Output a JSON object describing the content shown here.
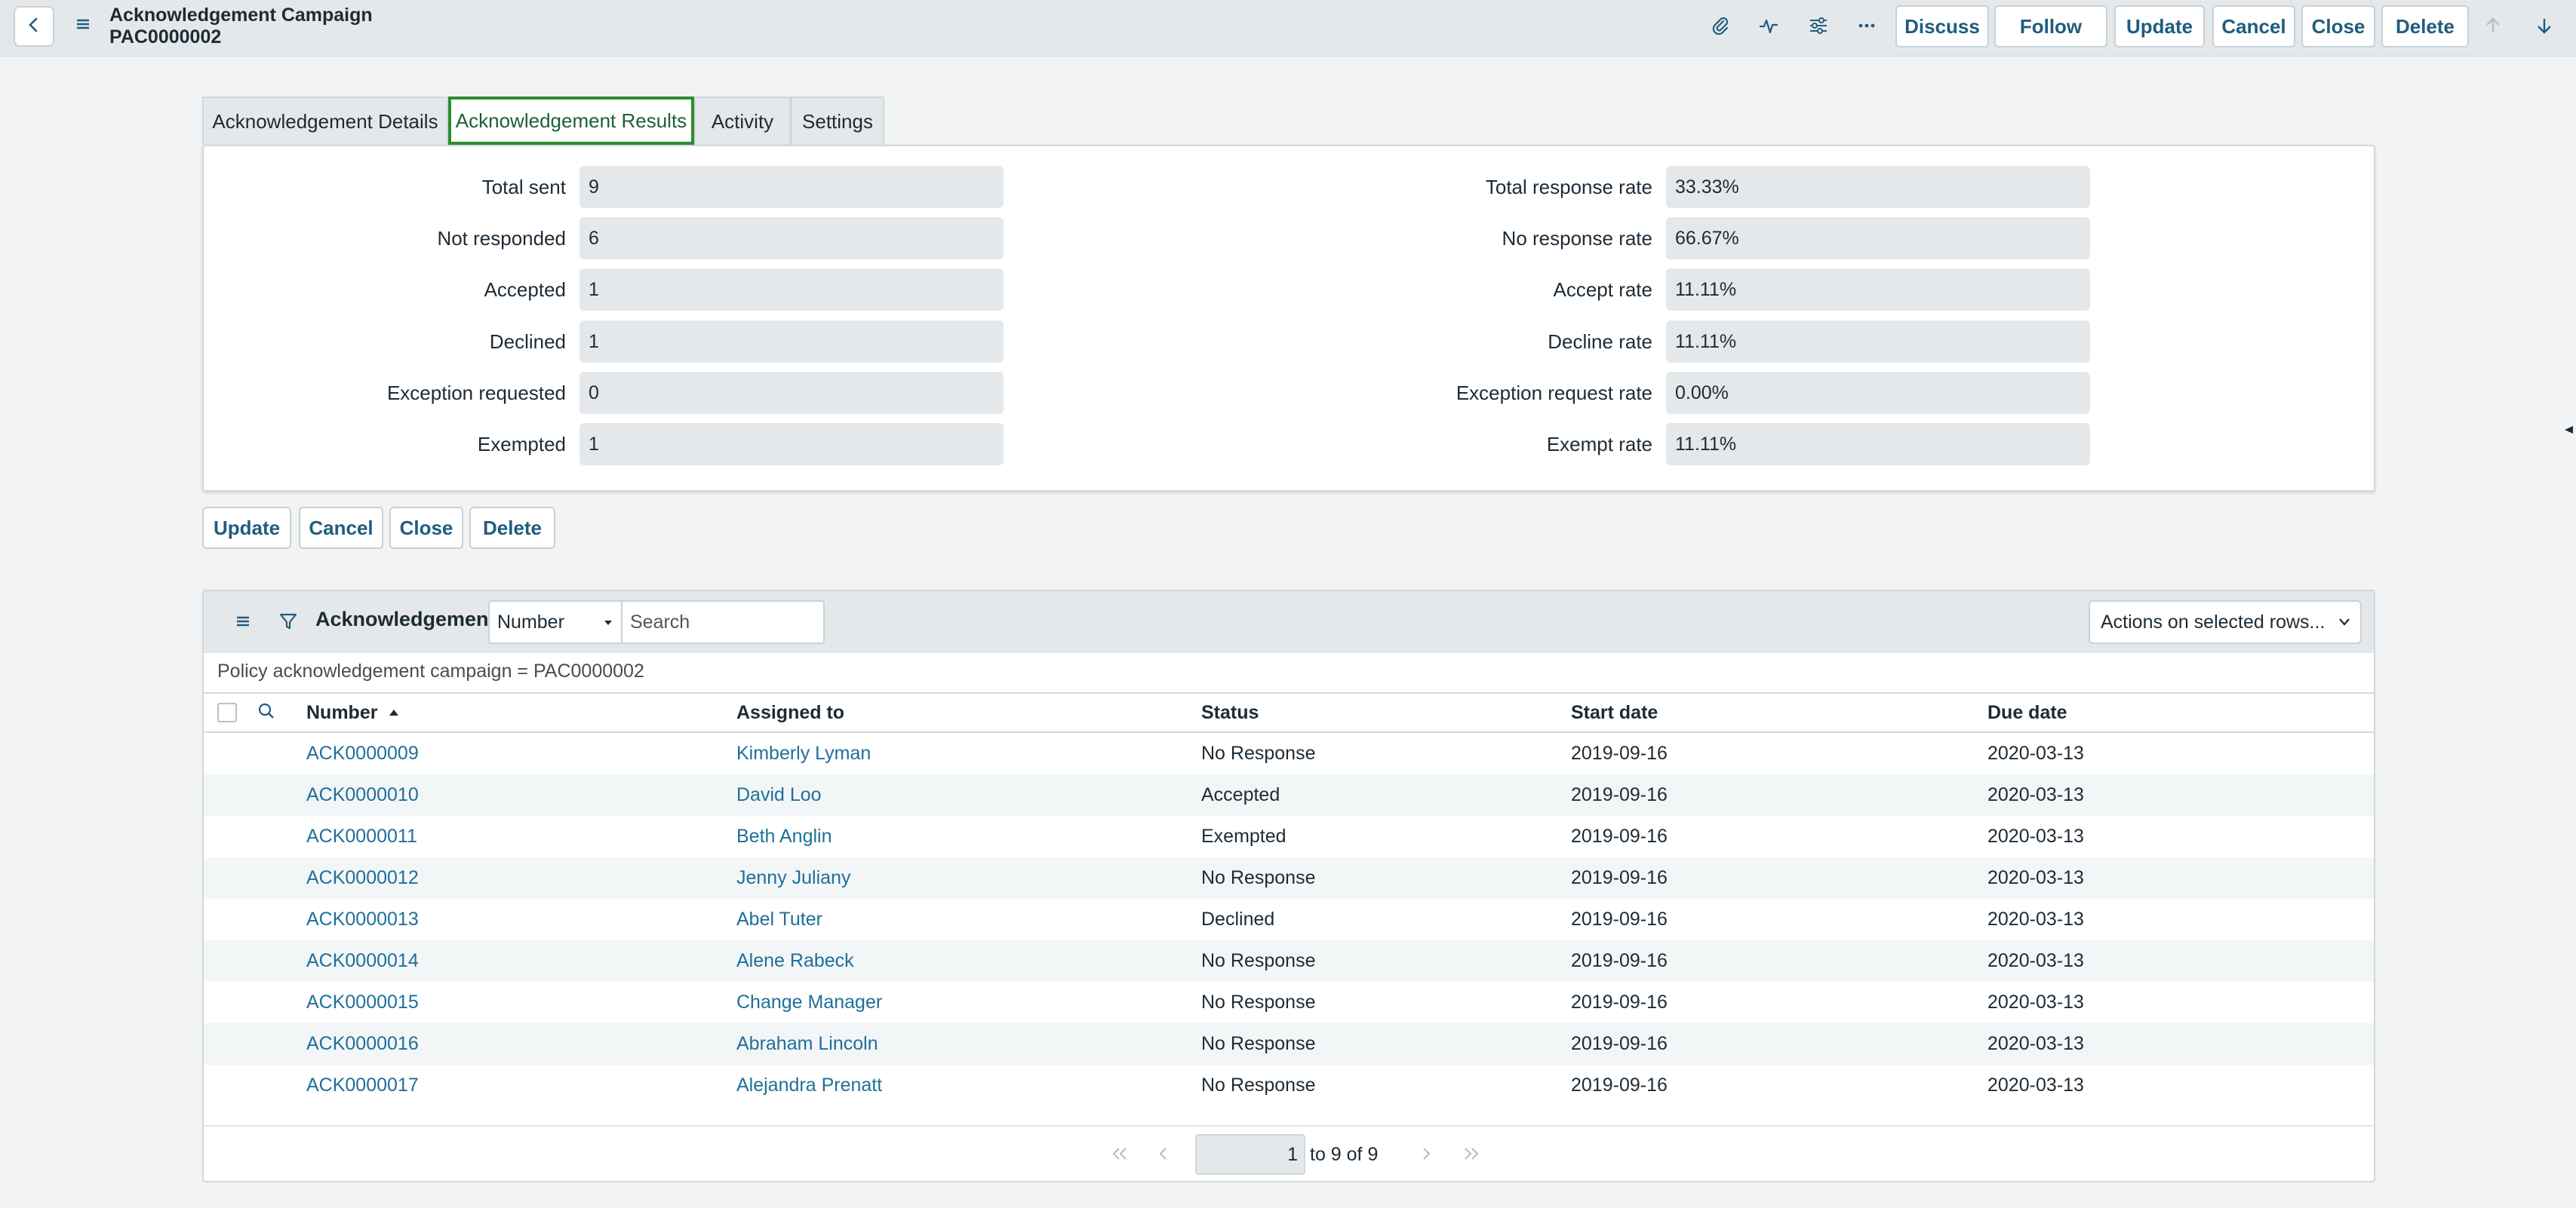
{
  "header": {
    "title": "Acknowledgement Campaign",
    "record_number": "PAC0000002",
    "icons": [
      "back-icon",
      "hamburger-icon",
      "paperclip-icon",
      "activity-icon",
      "sliders-icon",
      "more-icon",
      "arrow-up-icon",
      "arrow-down-icon"
    ],
    "buttons": {
      "discuss": "Discuss",
      "follow": "Follow",
      "update": "Update",
      "cancel": "Cancel",
      "close": "Close",
      "delete": "Delete"
    }
  },
  "tabs": [
    {
      "label": "Acknowledgement Details"
    },
    {
      "label": "Acknowledgement Results",
      "active": true
    },
    {
      "label": "Activity"
    },
    {
      "label": "Settings"
    }
  ],
  "results": {
    "left": [
      {
        "label": "Total sent",
        "value": "9"
      },
      {
        "label": "Not responded",
        "value": "6"
      },
      {
        "label": "Accepted",
        "value": "1"
      },
      {
        "label": "Declined",
        "value": "1"
      },
      {
        "label": "Exception requested",
        "value": "0"
      },
      {
        "label": "Exempted",
        "value": "1"
      }
    ],
    "right": [
      {
        "label": "Total response rate",
        "value": "33.33%"
      },
      {
        "label": "No response rate",
        "value": "66.67%"
      },
      {
        "label": "Accept rate",
        "value": "11.11%"
      },
      {
        "label": "Decline rate",
        "value": "11.11%"
      },
      {
        "label": "Exception request rate",
        "value": "0.00%"
      },
      {
        "label": "Exempt rate",
        "value": "11.11%"
      }
    ]
  },
  "form_buttons": {
    "update": "Update",
    "cancel": "Cancel",
    "close": "Close",
    "delete": "Delete"
  },
  "related_list": {
    "title": "Acknowledgements",
    "search_field": "Number",
    "search_placeholder": "Search",
    "actions_label": "Actions on selected rows...",
    "breadcrumb": "Policy acknowledgement campaign = PAC0000002",
    "columns": [
      "Number",
      "Assigned to",
      "Status",
      "Start date",
      "Due date"
    ],
    "sort_column": "Number",
    "sort_direction": "ascending",
    "rows": [
      {
        "number": "ACK0000009",
        "assigned_to": "Kimberly Lyman",
        "status": "No Response",
        "start_date": "2019-09-16",
        "due_date": "2020-03-13"
      },
      {
        "number": "ACK0000010",
        "assigned_to": "David Loo",
        "status": "Accepted",
        "start_date": "2019-09-16",
        "due_date": "2020-03-13"
      },
      {
        "number": "ACK0000011",
        "assigned_to": "Beth Anglin",
        "status": "Exempted",
        "start_date": "2019-09-16",
        "due_date": "2020-03-13"
      },
      {
        "number": "ACK0000012",
        "assigned_to": "Jenny Juliany",
        "status": "No Response",
        "start_date": "2019-09-16",
        "due_date": "2020-03-13"
      },
      {
        "number": "ACK0000013",
        "assigned_to": "Abel Tuter",
        "status": "Declined",
        "start_date": "2019-09-16",
        "due_date": "2020-03-13"
      },
      {
        "number": "ACK0000014",
        "assigned_to": "Alene Rabeck",
        "status": "No Response",
        "start_date": "2019-09-16",
        "due_date": "2020-03-13"
      },
      {
        "number": "ACK0000015",
        "assigned_to": "Change Manager",
        "status": "No Response",
        "start_date": "2019-09-16",
        "due_date": "2020-03-13"
      },
      {
        "number": "ACK0000016",
        "assigned_to": "Abraham Lincoln",
        "status": "No Response",
        "start_date": "2019-09-16",
        "due_date": "2020-03-13"
      },
      {
        "number": "ACK0000017",
        "assigned_to": "Alejandra Prenatt",
        "status": "No Response",
        "start_date": "2019-09-16",
        "due_date": "2020-03-13"
      }
    ],
    "pagination": {
      "current_page": "1",
      "range_text": "to 9 of 9"
    }
  },
  "colors": {
    "accent": "#1f5d7f",
    "link": "#1f6f99",
    "active_tab_border": "#2e8b2e",
    "header_bg": "#e4e8ea"
  }
}
